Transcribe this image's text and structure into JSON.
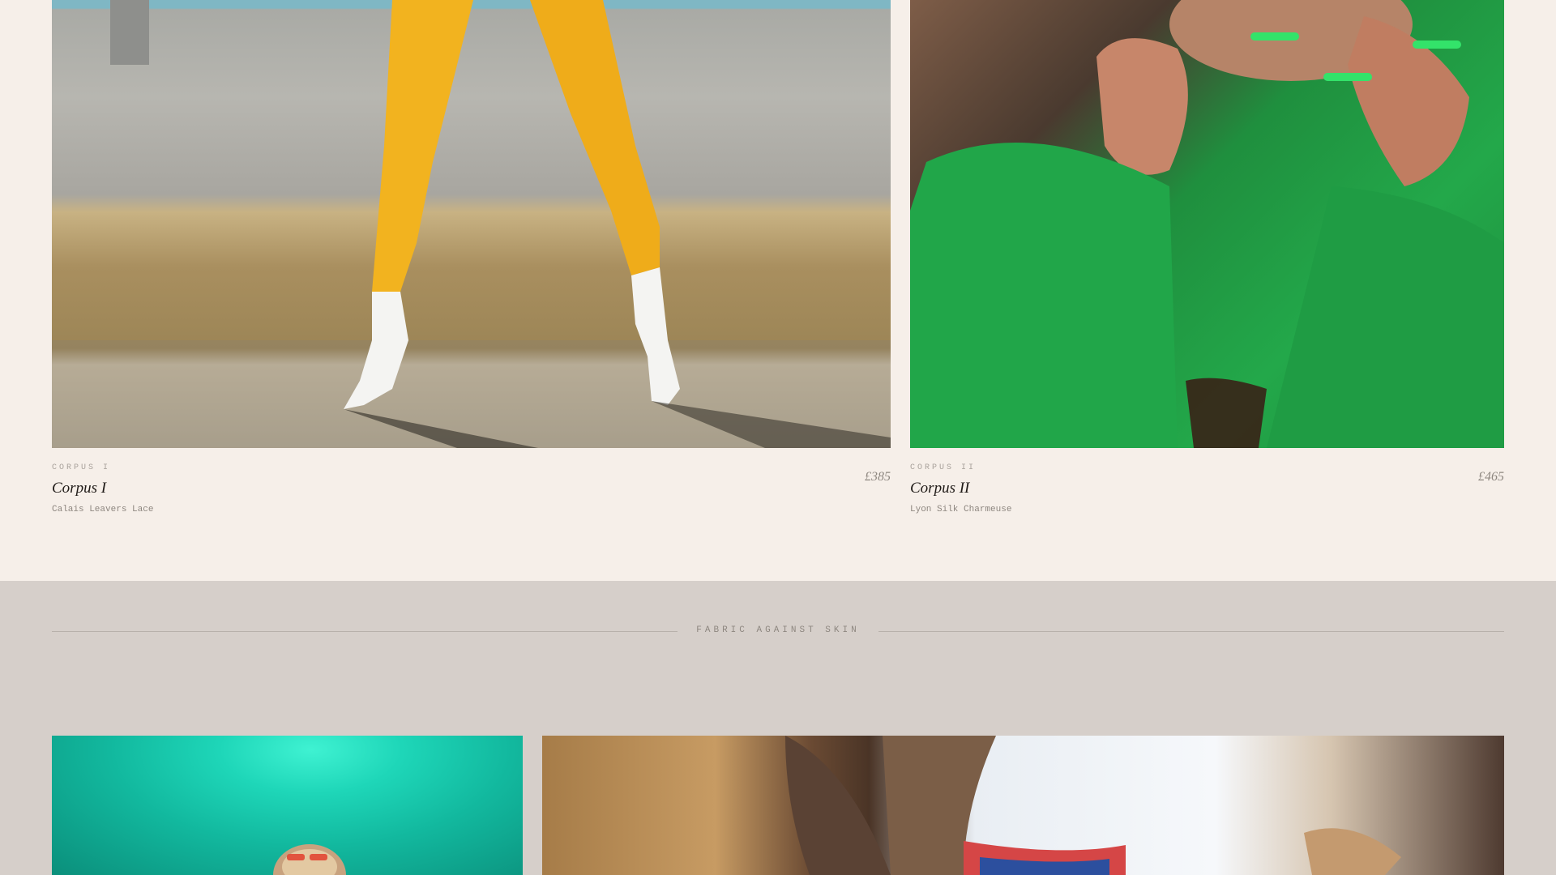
{
  "products": [
    {
      "eyebrow": "CORPUS I",
      "name": "Corpus I",
      "fabric": "Calais Leavers Lace",
      "price": "£385"
    },
    {
      "eyebrow": "CORPUS II",
      "name": "Corpus II",
      "fabric": "Lyon Silk Charmeuse",
      "price": "£465"
    }
  ],
  "section": {
    "label": "FABRIC AGAINST SKIN"
  },
  "colors": {
    "page_background": "#f6efe9",
    "section_background": "#d6cfca",
    "text_dark": "#1f1a17",
    "text_muted": "#8e8780"
  }
}
